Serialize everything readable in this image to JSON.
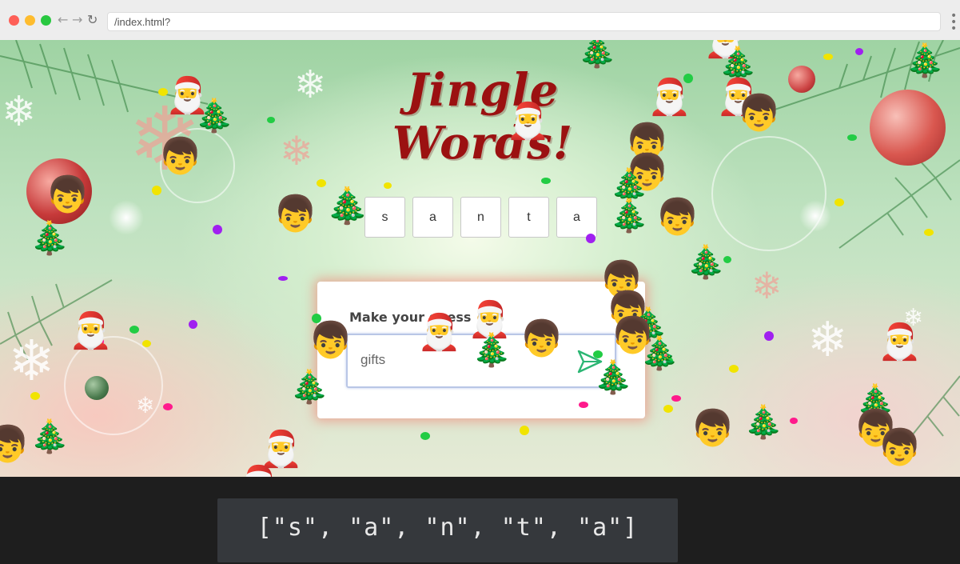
{
  "browser": {
    "url": "/index.html?",
    "back_glyph": "←",
    "forward_glyph": "→",
    "reload_glyph": "↻",
    "menu_glyph": "⋮"
  },
  "game": {
    "title": "Jingle Words!",
    "letters": [
      "s",
      "a",
      "n",
      "t",
      "a"
    ],
    "prompt_label": "Make your guess",
    "guess_value": "gifts",
    "send_icon": "send-icon"
  },
  "console_output": "[\"s\", \"a\", \"n\", \"t\", \"a\"]",
  "colors": {
    "title": "#9b1111",
    "card_glow": "#f5786e",
    "send_icon": "#2bb673",
    "console_bg": "#35383c"
  },
  "decorations": {
    "emoji_types": [
      "santa-emoji",
      "christmas-tree-emoji",
      "boy-emoji"
    ]
  }
}
